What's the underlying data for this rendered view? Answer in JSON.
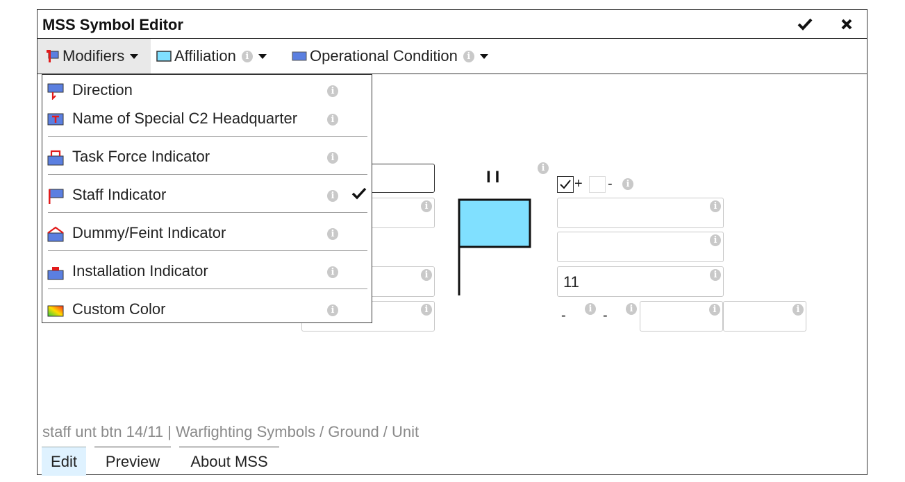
{
  "window": {
    "title": "MSS Symbol Editor",
    "ok_icon": "check-icon",
    "close_icon": "close-x-icon"
  },
  "menubar": {
    "modifiers_label": "Modifiers",
    "affiliation_label": "Affiliation",
    "operational_condition_label": "Operational Condition"
  },
  "modifiers_menu": {
    "items": [
      {
        "label": "Direction",
        "icon": "direction-icon",
        "checked": false
      },
      {
        "label": "Name of Special C2 Headquarter",
        "icon": "special-hq-icon",
        "checked": false
      },
      {
        "label": "Task Force Indicator",
        "icon": "task-force-icon",
        "checked": false
      },
      {
        "label": "Staff Indicator",
        "icon": "staff-indicator-icon",
        "checked": true
      },
      {
        "label": "Dummy/Feint Indicator",
        "icon": "dummy-feint-icon",
        "checked": false
      },
      {
        "label": "Installation Indicator",
        "icon": "installation-icon",
        "checked": false
      },
      {
        "label": "Custom Color",
        "icon": "custom-color-icon",
        "checked": false
      }
    ]
  },
  "symbol": {
    "echelon_text": "II",
    "frame_fill": "#80e0ff"
  },
  "fields": {
    "right_field_3_value": "11",
    "reinforced_sign": "+",
    "reduced_sign": "-",
    "dash_1": "-",
    "dash_2": "-"
  },
  "status": {
    "text": "staff unt btn 14/11 | Warfighting Symbols / Ground / Unit"
  },
  "tabs": [
    {
      "label": "Edit",
      "active": true
    },
    {
      "label": "Preview",
      "active": false
    },
    {
      "label": "About MSS",
      "active": false
    }
  ]
}
